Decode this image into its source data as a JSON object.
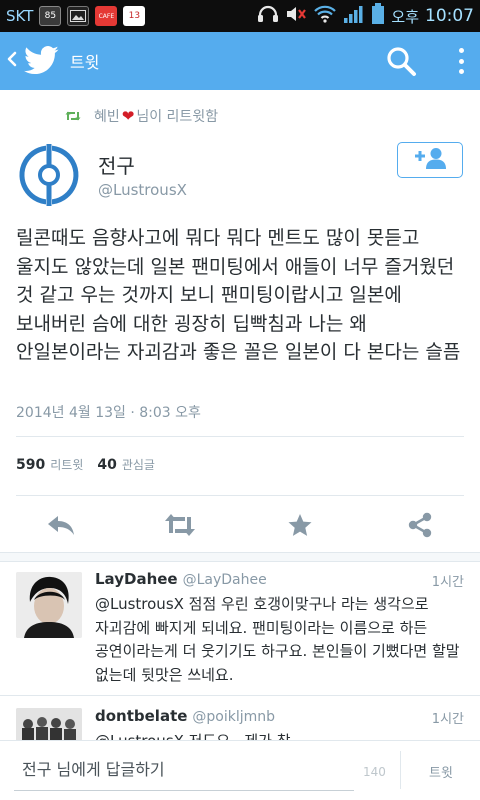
{
  "status_bar": {
    "carrier": "SKT",
    "notif_weather": "85",
    "notif_cafe": "CAFE",
    "notif_calendar": "13",
    "time_prefix": "오후",
    "time": "10:07"
  },
  "app_bar": {
    "title": "트윗"
  },
  "retweet_context": {
    "user": "혜빈",
    "suffix": "님이 리트윗함"
  },
  "tweet": {
    "author_name": "전구",
    "author_handle": "@LustrousX",
    "text": "릴콘때도 음향사고에 뭐다 뭐다 멘트도 많이 못듣고 울지도 않았는데 일본 팬미팅에서 애들이 너무 즐거웠던 것 같고 우는 것까지 보니 팬미팅이랍시고 일본에 보내버린 슴에 대한 굉장히 딥빡침과 나는 왜 안일본이라는 자괴감과 좋은 꼴은 일본이 다 본다는 슬픔",
    "timestamp": "2014년 4월 13일 · 8:03 오후",
    "retweet_count": "590",
    "retweet_label": "리트윗",
    "favorite_count": "40",
    "favorite_label": "관심글"
  },
  "replies": [
    {
      "name": "LayDahee",
      "handle": "@LayDahee",
      "time": "1시간",
      "text": "@LustrousX 점점 우린 호갱이맞구나 라는 생각으로 자괴감에 빠지게 되네요. 팬미팅이라는 이름으로 하든 공연이라는게 더 웃기기도 하구요. 본인들이 기뻤다면 할말 없는데 뒷맛은 쓰네요."
    },
    {
      "name": "dontbelate",
      "handle": "@poikljmnb",
      "time": "1시간",
      "text": "@LustrousX 저도요.. 제가 참"
    }
  ],
  "compose": {
    "placeholder": "전구 님에게 답글하기",
    "char_count": "140",
    "submit_label": "트윗"
  },
  "colors": {
    "brand": "#55acee",
    "retweet_green": "#5fb05a",
    "heart_red": "#d31d27",
    "muted": "#8899a6"
  }
}
